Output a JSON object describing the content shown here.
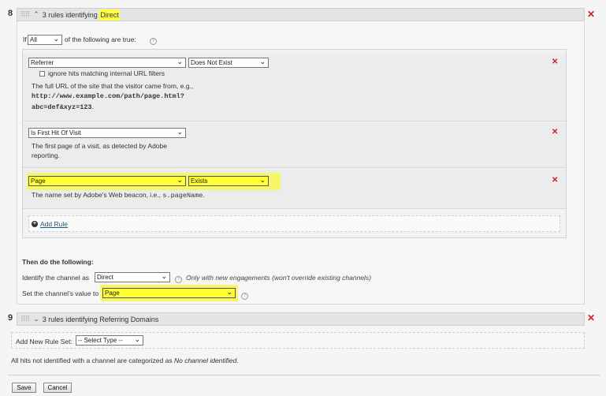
{
  "ruleset8": {
    "number": "8",
    "title_prefix": "3 rules identifying ",
    "title_highlight": "Direct",
    "condition": {
      "if_label": "If",
      "match_value": "All",
      "match_suffix": "of the following are true:"
    },
    "rules": [
      {
        "field": "Referrer",
        "operator": "Does Not Exist",
        "checkbox_label": "ignore hits matching internal URL filters",
        "description": "The full URL of the site that the visitor came from, e.g.,",
        "example_line1": "http://www.example.com/path/page.html?",
        "example_line2": "abc=def&xyz=123",
        "example_end": "."
      },
      {
        "field": "Is First Hit Of Visit",
        "description_line1": "The first page of a visit, as detected by Adobe",
        "description_line2": "reporting."
      },
      {
        "field": "Page",
        "operator": "Exists",
        "description": "The name set by Adobe's Web beacon, i.e.,",
        "code": "s.pageName",
        "description_end": "."
      }
    ],
    "add_rule_label": "Add Rule",
    "then_label": "Then do the following:",
    "identify_label": "Identify the channel as",
    "identify_value": "Direct",
    "identify_note": "Only with new engagements (won't override existing channels)",
    "set_value_label": "Set the channel's value to",
    "set_value_value": "Page"
  },
  "ruleset9": {
    "number": "9",
    "title": "3 rules identifying Referring Domains"
  },
  "add_ruleset": {
    "label": "Add New Rule Set:",
    "select_value": "-- Select Type --"
  },
  "footer_note_prefix": "All hits not identified with a channel are categorized as ",
  "footer_note_italic": "No channel identified",
  "footer_note_end": ".",
  "buttons": {
    "save": "Save",
    "cancel": "Cancel"
  },
  "icons": {
    "grip": "drag-handle-icon",
    "collapse": "chevron-up-icon",
    "expand": "chevron-down-icon",
    "remove": "close-x-icon",
    "help": "help-icon",
    "add": "plus-circle-icon"
  },
  "colors": {
    "highlight": "#ffff33",
    "remove": "#cc2222",
    "header_bg": "#e4e4e4",
    "rule_bg": "#ececec"
  }
}
